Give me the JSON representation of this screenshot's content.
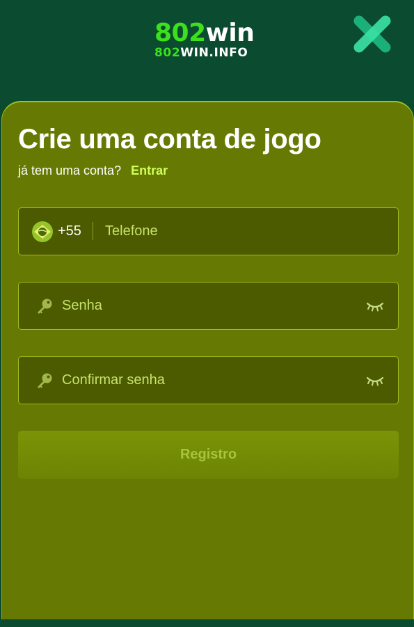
{
  "logo": {
    "brand_digits": "802",
    "brand_word": "win",
    "domain_digits": "802",
    "domain_rest": "WIN.INFO"
  },
  "header": {
    "close_icon": "close-x-icon"
  },
  "form": {
    "title": "Crie uma conta de jogo",
    "have_account_text": "já tem uma conta?",
    "login_link": "Entrar",
    "phone": {
      "country_flag_icon": "brazil-flag-icon",
      "dial_code": "+55",
      "placeholder": "Telefone",
      "value": ""
    },
    "password": {
      "icon": "key-icon",
      "placeholder": "Senha",
      "value": "",
      "toggle_icon": "eye-closed-icon"
    },
    "confirm_password": {
      "icon": "key-icon",
      "placeholder": "Confirmar senha",
      "value": "",
      "toggle_icon": "eye-closed-icon"
    },
    "submit_label": "Registro"
  },
  "colors": {
    "header_bg": "#0b4b2f",
    "sheet_bg": "#667a03",
    "field_bg": "#4c5a00",
    "accent_green": "#3ce01c",
    "link_color": "#cfff5a",
    "button_bg": "#7a9407"
  }
}
